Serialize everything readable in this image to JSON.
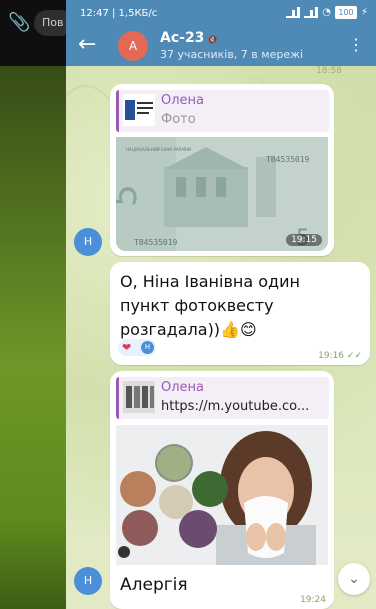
{
  "desktop": {
    "clip_icon": "paperclip-icon",
    "pill_text": "Пов"
  },
  "status_bar": {
    "time_speed": "12:47 | 1,5КБ/с",
    "battery": "100"
  },
  "header": {
    "chat_title": "Ас-23",
    "avatar_letter": "А",
    "subtitle": "37 учасників, 7 в мережі",
    "colors": {
      "header_bg": "#4f8ab7",
      "avatar_bg": "#e26a55"
    }
  },
  "previous_message": {
    "time": "18:58"
  },
  "messages": [
    {
      "type": "photo_reply",
      "reply_name": "Олена",
      "reply_sub": "Фото",
      "banknote_serial_top": "ТВ4535019",
      "banknote_serial_bottom": "ТВ4535019",
      "banknote_value": "5",
      "banknote_header": "НАЦІОНАЛЬНИЙ БАНК УКРАЇНИ",
      "time": "19:15",
      "sender_avatar": "Н"
    },
    {
      "type": "text",
      "text": "О, Ніна Іванівна один пункт фотоквесту розгадала))👍😊",
      "reaction": "❤",
      "reaction_avatar": "Н",
      "time": "19:16"
    },
    {
      "type": "link_reply",
      "reply_name": "Олена",
      "reply_link": "https://m.youtube.co...",
      "media_caption": "Алергія",
      "time": "19:24",
      "sender_avatar": "Н"
    }
  ]
}
